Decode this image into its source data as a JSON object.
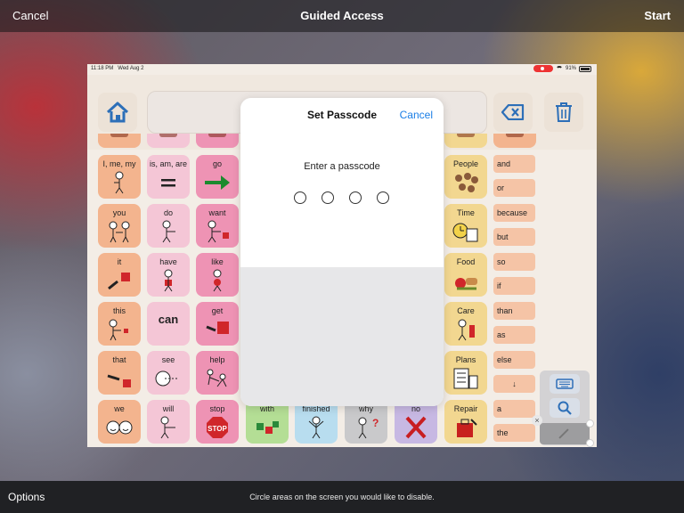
{
  "guided_access": {
    "cancel_label": "Cancel",
    "title": "Guided Access",
    "start_label": "Start",
    "options_label": "Options",
    "hint": "Circle areas on the screen you would like to disable."
  },
  "status_bar": {
    "time": "11:18 PM",
    "date": "Wed Aug 2",
    "battery": "91%"
  },
  "passcode_dialog": {
    "title": "Set Passcode",
    "cancel_label": "Cancel",
    "prompt": "Enter a passcode",
    "digits_entered": 0,
    "digits_total": 4
  },
  "vocab": {
    "col1": [
      "I, me, my",
      "you",
      "it",
      "this",
      "that",
      "we"
    ],
    "col2": [
      "is, am, are",
      "do",
      "have",
      "can",
      "see",
      "will"
    ],
    "col3": [
      "go",
      "want",
      "like",
      "get",
      "help",
      "stop"
    ],
    "bottom_row": [
      "with",
      "finished",
      "why",
      "no"
    ],
    "categories": [
      "People",
      "Time",
      "Food",
      "Care",
      "Plans",
      "Repair"
    ],
    "words": [
      "and",
      "or",
      "because",
      "but",
      "so",
      "if",
      "than",
      "as",
      "else",
      "a",
      "the"
    ]
  },
  "icons": {
    "home": "home-icon",
    "backspace": "backspace-icon",
    "trash": "trash-icon",
    "keyboard": "keyboard-icon",
    "search": "search-icon",
    "arrow_down": "arrow-down-icon",
    "close": "close-icon"
  },
  "colors": {
    "accent": "#1a7ee6",
    "home_icon": "#2d6fb8"
  },
  "symbols": {
    "stop_sign": "STOP",
    "why_mark": "?",
    "arrow_down": "↓",
    "close_mark": "×"
  }
}
